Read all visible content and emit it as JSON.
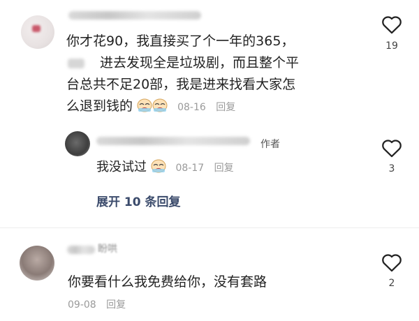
{
  "comments": [
    {
      "text_line1": "你才花90，我直接买了个一年的365，",
      "text_line2": "进去发现全是垃圾剧，而且整个平",
      "text_line3": "台总共不足20部，我是进来找看大家怎",
      "text_line4": "么退到钱的",
      "date": "08-16",
      "reply_label": "回复",
      "likes": "19",
      "emoji_icons": [
        "crying-face-icon",
        "crying-face-icon"
      ],
      "sub_reply": {
        "author_badge": "作者",
        "text": "我没试过",
        "emoji_icon": "crying-face-icon",
        "date": "08-17",
        "reply_label": "回复",
        "likes": "3"
      },
      "expand_label": "展开 10 条回复"
    },
    {
      "name_fragment": "盼哄",
      "text": "你要看什么我免费给你，没有套路",
      "date": "09-08",
      "reply_label": "回复",
      "likes": "2"
    }
  ],
  "colors": {
    "text": "#222222",
    "meta": "#9a9a9a",
    "expand": "#3a4a6b",
    "heart_outline": "#222222"
  }
}
